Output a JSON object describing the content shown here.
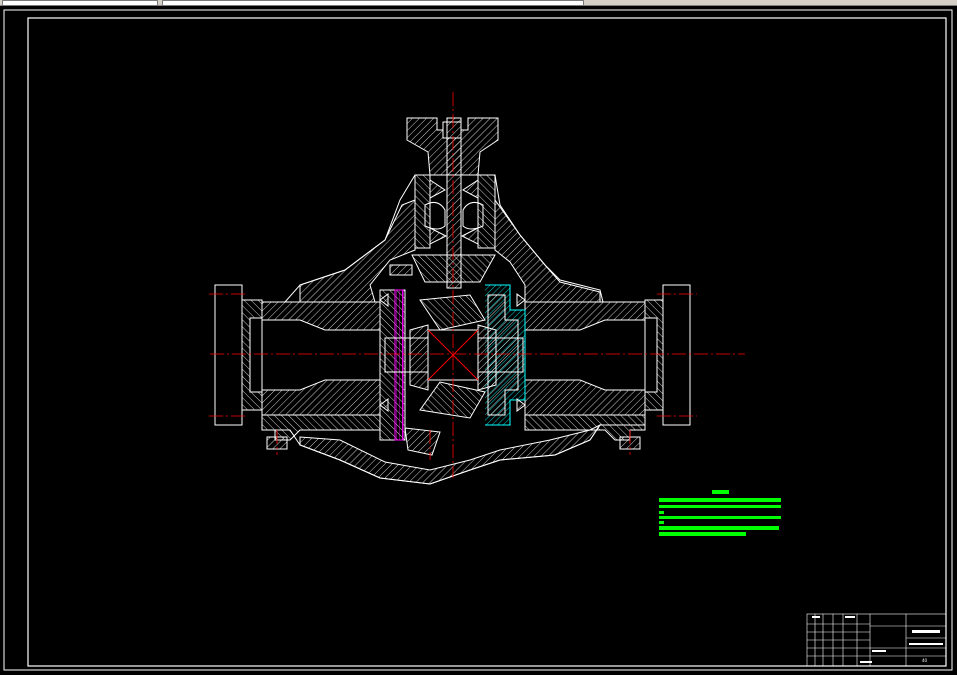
{
  "toolbar": {
    "fields": [
      "",
      ""
    ]
  },
  "drawing": {
    "background": "#000000",
    "line_color": "#ffffff",
    "centerline_color": "#ff0000",
    "note_color": "#00ff00",
    "accent_colors": [
      "#00ffff",
      "#ff00ff"
    ],
    "technical_notes_lines": 6,
    "title_block": {
      "sheet_mark": "40"
    }
  }
}
